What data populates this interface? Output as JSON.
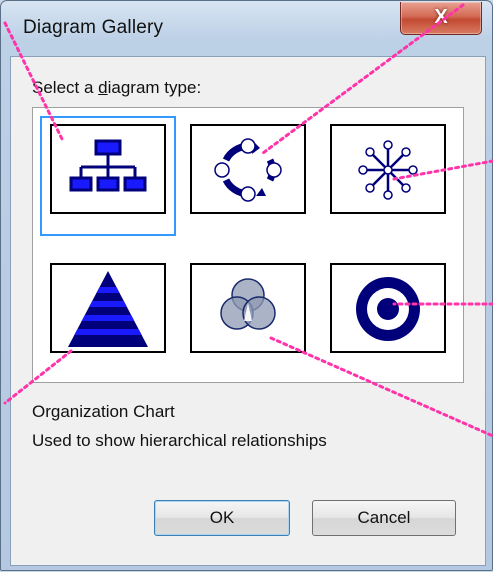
{
  "window": {
    "title": "Diagram Gallery",
    "close_glyph": "X"
  },
  "prompt": {
    "text_prefix": "Select a ",
    "text_accel": "d",
    "text_suffix": "iagram type:"
  },
  "gallery": {
    "items": [
      {
        "icon": "organization-chart-icon",
        "selected": true
      },
      {
        "icon": "cycle-diagram-icon",
        "selected": false
      },
      {
        "icon": "radial-diagram-icon",
        "selected": false
      },
      {
        "icon": "pyramid-diagram-icon",
        "selected": false
      },
      {
        "icon": "venn-diagram-icon",
        "selected": false
      },
      {
        "icon": "target-diagram-icon",
        "selected": false
      }
    ]
  },
  "description": {
    "name": "Organization Chart",
    "text": "Used to show hierarchical relationships"
  },
  "buttons": {
    "ok": "OK",
    "cancel": "Cancel"
  },
  "colors": {
    "navy": "#00007a",
    "blue": "#1a1aff",
    "selection": "#3399ff",
    "annotation": "#ff33aa"
  }
}
